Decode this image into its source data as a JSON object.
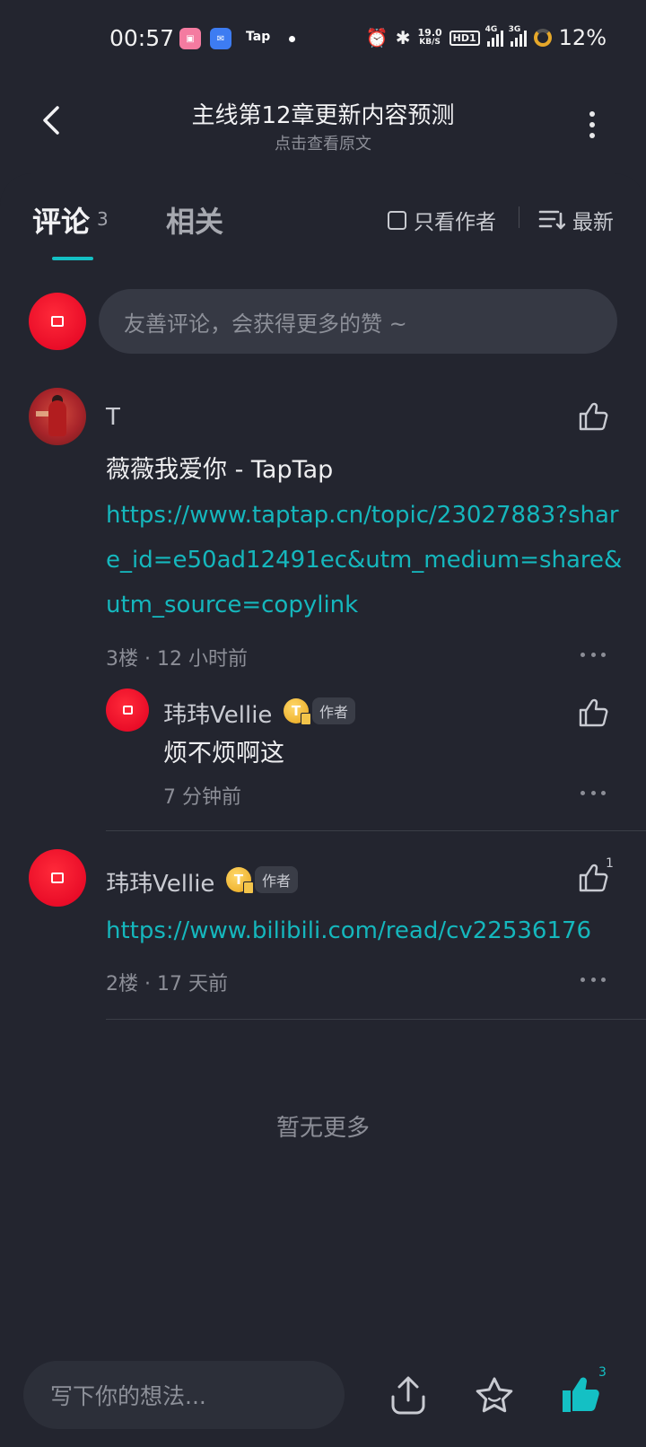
{
  "status_bar": {
    "time": "00:57",
    "app_icons": [
      "bilibili-icon",
      "mail-icon"
    ],
    "tap_label": "Tap",
    "net_speed_value": "19.0",
    "net_speed_unit": "KB/S",
    "hd_label": "HD1",
    "signal_1_label": "4G",
    "signal_2_label": "3G",
    "battery": "12%"
  },
  "header": {
    "title": "主线第12章更新内容预测",
    "subtitle": "点击查看原文"
  },
  "tabs": {
    "comments_label": "评论",
    "comments_count": "3",
    "related_label": "相关",
    "author_only_label": "只看作者",
    "sort_label": "最新"
  },
  "composer": {
    "placeholder": "友善评论，会获得更多的赞 ~"
  },
  "comments": [
    {
      "author": "T",
      "text": "薇薇我爱你 - TapTap",
      "link": "https://www.taptap.cn/topic/23027883?share_id=e50ad12491ec&utm_medium=share&utm_source=copylink",
      "floor": "3楼",
      "time": "12 小时前",
      "reply": {
        "author": "玮玮Vellie",
        "badge": "T",
        "tag": "作者",
        "text": "烦不烦啊这",
        "time": "7 分钟前"
      }
    },
    {
      "author": "玮玮Vellie",
      "badge": "T",
      "tag": "作者",
      "link": "https://www.bilibili.com/read/cv22536176",
      "floor": "2楼",
      "time": "17 天前",
      "likes": "1"
    }
  ],
  "separator": " · ",
  "no_more": "暂无更多",
  "bottom_bar": {
    "placeholder": "写下你的想法...",
    "like_count": "3"
  },
  "colors": {
    "background": "#23252f",
    "accent": "#14c0c4",
    "link": "#15b7bd",
    "avatar_red": "#ff1a35"
  }
}
